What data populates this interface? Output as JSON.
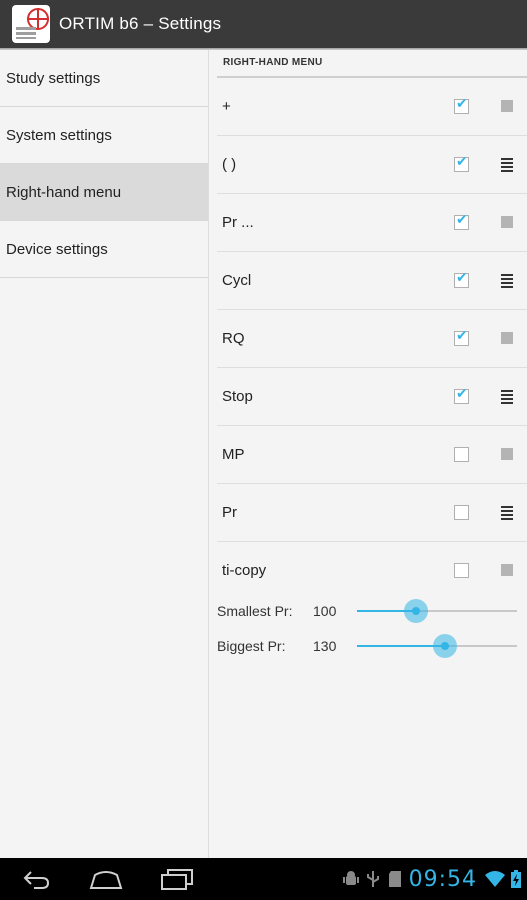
{
  "app": {
    "title": "ORTIM b6 – Settings"
  },
  "left_menu": {
    "items": [
      {
        "label": "Study settings",
        "selected": false
      },
      {
        "label": "System settings",
        "selected": false
      },
      {
        "label": "Right-hand menu",
        "selected": true
      },
      {
        "label": "Device settings",
        "selected": false
      }
    ]
  },
  "right_panel": {
    "header": "RIGHT-HAND MENU",
    "rows": [
      {
        "label": "+",
        "checked": true,
        "icon": "square-icon"
      },
      {
        "label": "( )",
        "checked": true,
        "icon": "drag-handle-icon"
      },
      {
        "label": "Pr ...",
        "checked": true,
        "icon": "square-icon"
      },
      {
        "label": "Cycl",
        "checked": true,
        "icon": "drag-handle-icon"
      },
      {
        "label": "RQ",
        "checked": true,
        "icon": "square-icon"
      },
      {
        "label": "Stop",
        "checked": true,
        "icon": "drag-handle-icon"
      },
      {
        "label": "MP",
        "checked": false,
        "icon": "square-icon"
      },
      {
        "label": "Pr",
        "checked": false,
        "icon": "drag-handle-icon"
      },
      {
        "label": "ti-copy",
        "checked": false,
        "icon": "square-icon"
      }
    ],
    "sliders": [
      {
        "label": "Smallest Pr:",
        "value": "100",
        "fraction": 0.37
      },
      {
        "label": "Biggest Pr:",
        "value": "130",
        "fraction": 0.55
      }
    ]
  },
  "status_bar": {
    "time": "09:54",
    "icons": [
      "android-debug-icon",
      "usb-icon",
      "sd-card-icon",
      "wifi-icon",
      "battery-charging-icon"
    ]
  },
  "nav_bar": {
    "buttons": [
      "back-icon",
      "home-icon",
      "recent-apps-icon"
    ]
  },
  "colors": {
    "accent": "#33b5e5",
    "action_bar": "#3a3a3a"
  }
}
